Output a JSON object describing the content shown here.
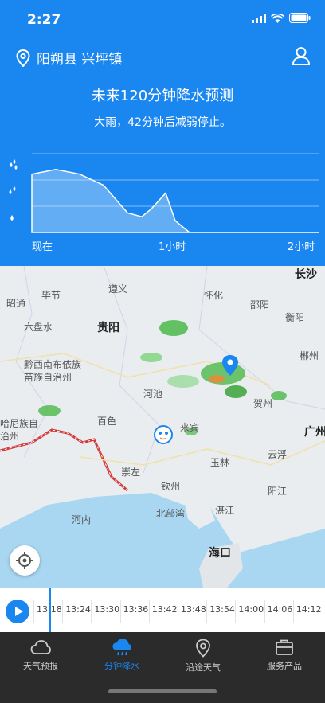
{
  "status": {
    "time": "2:27"
  },
  "header": {
    "location": "阳朔县 兴坪镇",
    "forecast_title": "未来120分钟降水预测",
    "forecast_subtitle": "大雨，42分钟后减弱停止。"
  },
  "chart_data": {
    "type": "area",
    "x_labels": [
      "现在",
      "1小时",
      "2小时"
    ],
    "levels": [
      "heavy",
      "moderate",
      "light"
    ],
    "x_minutes": [
      0,
      10,
      20,
      30,
      40,
      46,
      50,
      56,
      60,
      66,
      70,
      120
    ],
    "intensity": [
      0.74,
      0.8,
      0.74,
      0.6,
      0.25,
      0.2,
      0.3,
      0.5,
      0.15,
      0.0,
      0.0,
      0.0
    ],
    "ylim": [
      0,
      1
    ],
    "color": "#ffffff"
  },
  "map": {
    "cities": [
      "长沙",
      "毕节",
      "遵义",
      "怀化",
      "邵阳",
      "衡阳",
      "昭通",
      "六盘水",
      "贵阳",
      "郴州",
      "黔西南布依族苗族自治州",
      "河池",
      "贺州",
      "百色",
      "来宾",
      "广州",
      "哈尼族自治州",
      "崇左",
      "玉林",
      "云浮",
      "钦州",
      "阳江",
      "河内",
      "北部湾",
      "湛江",
      "海口"
    ],
    "pin_color": "#1a86f0"
  },
  "timeline": {
    "ticks": [
      "13:18",
      "13:24",
      "13:30",
      "13:36",
      "13:42",
      "13:48",
      "13:54",
      "14:00",
      "14:06",
      "14:12"
    ]
  },
  "tabs": [
    {
      "label": "天气预报",
      "icon": "cloud-icon"
    },
    {
      "label": "分钟降水",
      "icon": "rain-cloud-icon",
      "active": true
    },
    {
      "label": "沿途天气",
      "icon": "location-pin-icon"
    },
    {
      "label": "服务产品",
      "icon": "briefcase-icon"
    }
  ],
  "colors": {
    "primary": "#1a86f0",
    "tabbar": "#2b2b2b"
  }
}
